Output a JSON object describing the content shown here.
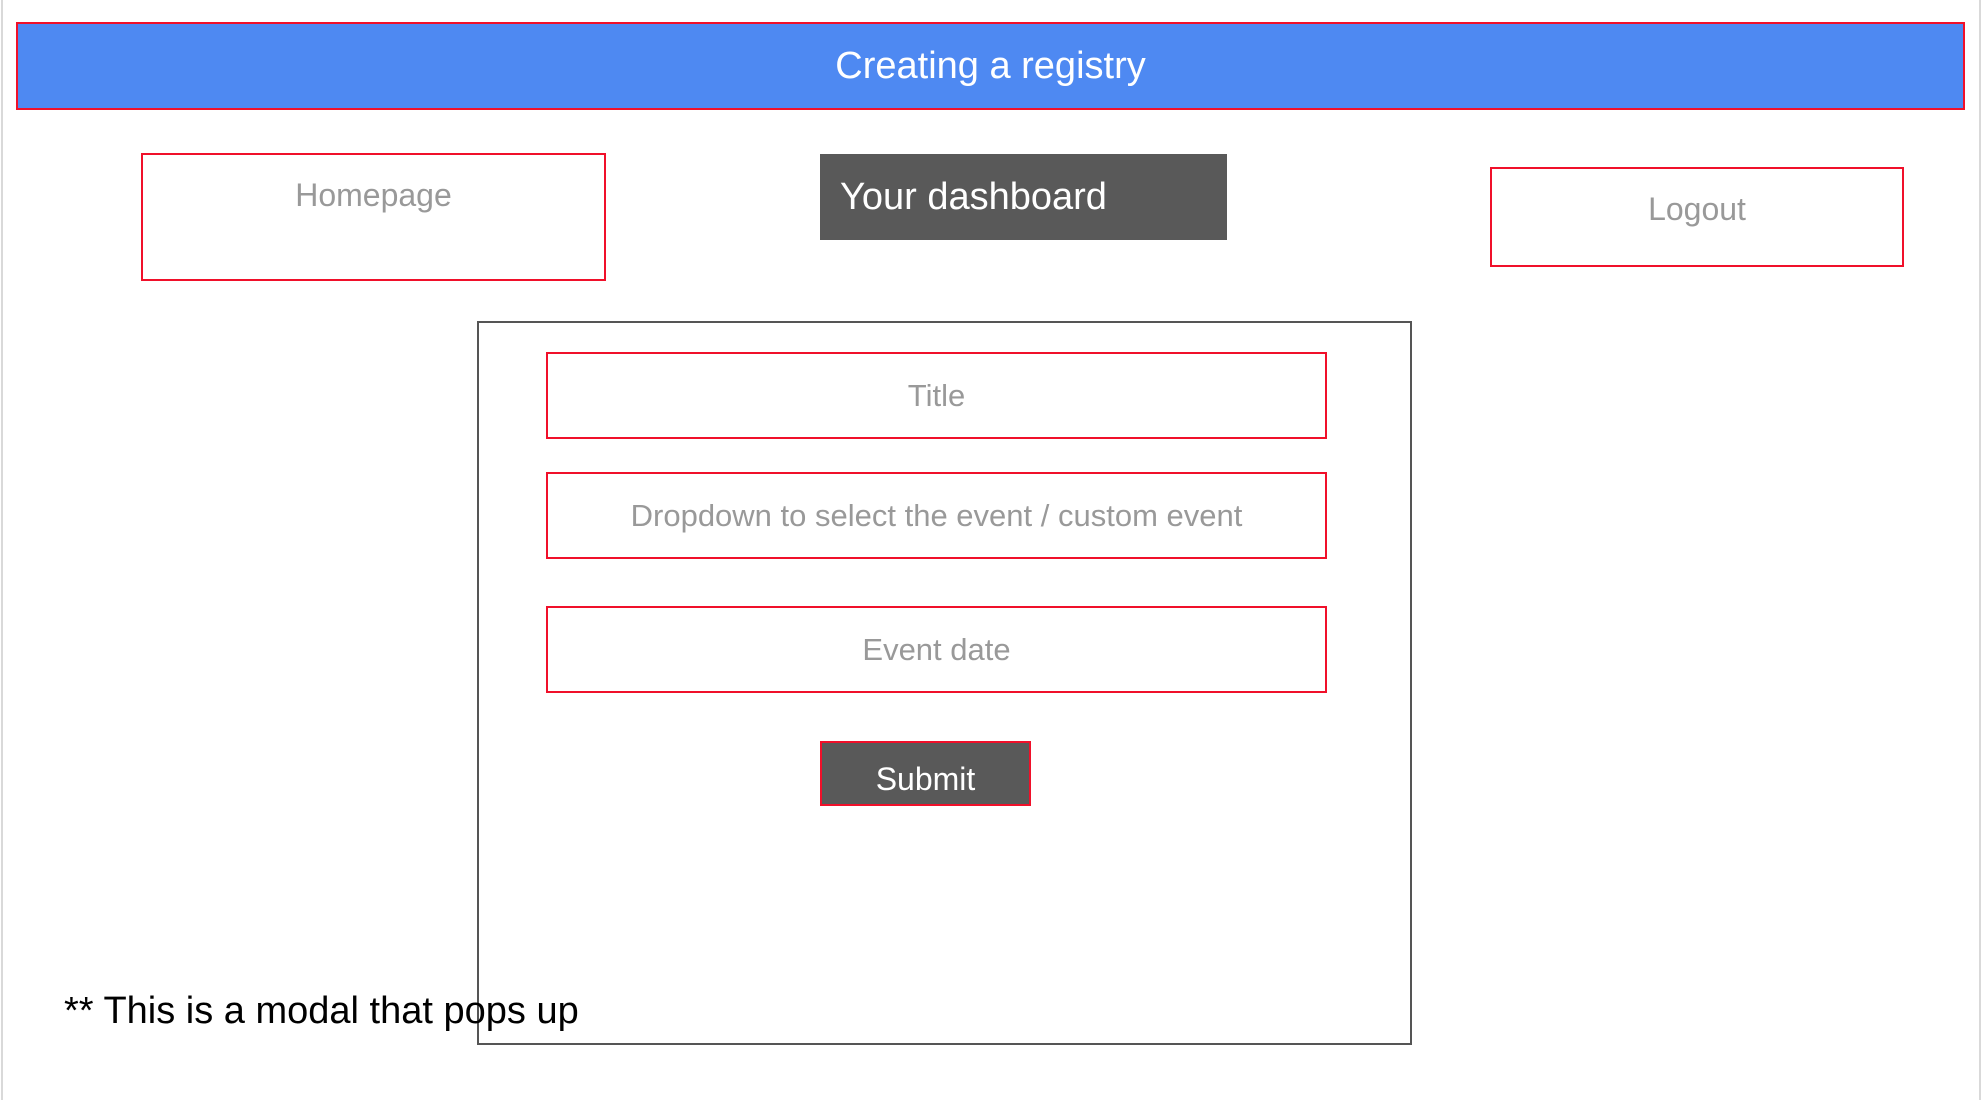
{
  "header": {
    "title": "Creating a registry"
  },
  "nav": {
    "homepage": "Homepage",
    "dashboard": "Your dashboard",
    "logout": "Logout"
  },
  "modal": {
    "title_field": "Title",
    "event_dropdown": "Dropdown to select the event / custom event",
    "event_date_field": "Event date",
    "submit": "Submit"
  },
  "note": "** This is a modal that pops up",
  "colors": {
    "header": "#4e89f2",
    "outline": "#f0102a",
    "dark_button": "#595959"
  }
}
